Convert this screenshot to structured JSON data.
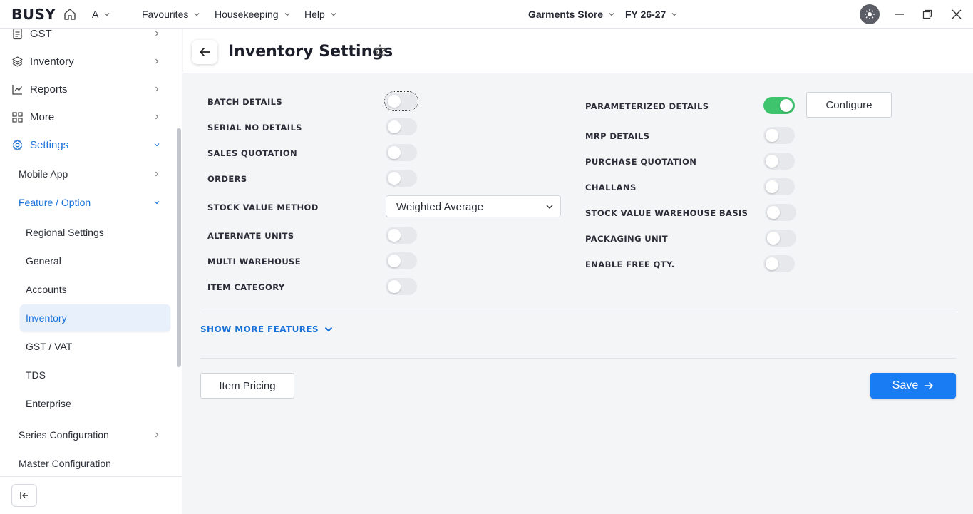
{
  "app": {
    "logo": "BUSY",
    "company_initial": "A",
    "menus": [
      "Favourites",
      "Housekeeping",
      "Help"
    ],
    "store": "Garments Store",
    "fiscal_year": "FY 26-27"
  },
  "sidebar": {
    "items": [
      {
        "label": "GST",
        "icon": "document-icon"
      },
      {
        "label": "Inventory",
        "icon": "layers-icon"
      },
      {
        "label": "Reports",
        "icon": "chart-line-icon"
      },
      {
        "label": "More",
        "icon": "grid-icon"
      },
      {
        "label": "Settings",
        "icon": "gear-icon"
      }
    ],
    "settings_children": [
      "Mobile App",
      "Feature / Option"
    ],
    "feature_children": [
      "Regional Settings",
      "General",
      "Accounts",
      "Inventory",
      "GST / VAT",
      "TDS",
      "Enterprise"
    ],
    "more_children": [
      "Series Configuration",
      "Master Configuration"
    ],
    "selected": "Inventory"
  },
  "page": {
    "title": "Inventory Settings",
    "left_fields": [
      {
        "label": "BATCH DETAILS",
        "on": false
      },
      {
        "label": "SERIAL NO DETAILS",
        "on": false
      },
      {
        "label": "SALES QUOTATION",
        "on": false
      },
      {
        "label": "ORDERS",
        "on": false
      },
      {
        "label": "STOCK VALUE METHOD",
        "value": "Weighted Average"
      },
      {
        "label": "ALTERNATE UNITS",
        "on": false
      },
      {
        "label": "MULTI WAREHOUSE",
        "on": false
      },
      {
        "label": "ITEM CATEGORY",
        "on": false
      }
    ],
    "right_fields": [
      {
        "label": "PARAMETERIZED DETAILS",
        "on": true
      },
      {
        "label": "MRP DETAILS",
        "on": false
      },
      {
        "label": "PURCHASE QUOTATION",
        "on": false
      },
      {
        "label": "CHALLANS",
        "on": false
      },
      {
        "label": "STOCK VALUE WAREHOUSE BASIS",
        "on": false
      },
      {
        "label": "PACKAGING UNIT",
        "on": false
      },
      {
        "label": "ENABLE FREE QTY.",
        "on": false
      }
    ],
    "configure_label": "Configure",
    "show_more_label": "SHOW MORE FEATURES",
    "item_pricing_label": "Item Pricing",
    "save_label": "Save"
  },
  "colors": {
    "accent": "#1a7cf2",
    "toggle_on": "#3ec46d",
    "link": "#1672d8"
  }
}
